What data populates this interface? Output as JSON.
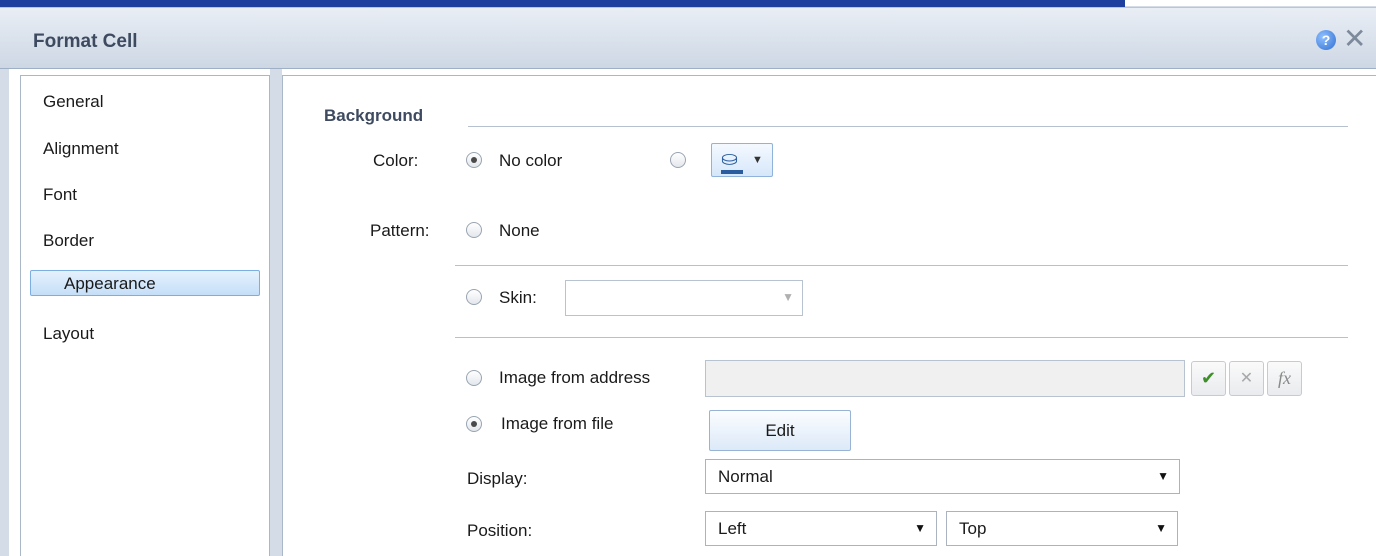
{
  "dialog": {
    "title": "Format Cell",
    "help_icon": "question-mark-icon",
    "close_icon": "close-x-icon"
  },
  "nav": {
    "items": [
      "General",
      "Alignment",
      "Font",
      "Border",
      "Appearance",
      "Layout"
    ],
    "selected": "Appearance"
  },
  "background": {
    "section_title": "Background",
    "color_label": "Color:",
    "no_color_label": "No color",
    "no_color_checked": true,
    "custom_color_checked": false,
    "color_picker_icon": "paint-bucket-icon",
    "pattern_label": "Pattern:",
    "none_label": "None",
    "skin_label": "Skin:",
    "skin_value": "",
    "image_address_label": "Image from address",
    "image_address_value": "",
    "confirm_icon": "checkmark-icon",
    "cancel_icon": "x-icon",
    "fx_label": "fx",
    "image_file_label": "Image from file",
    "image_file_checked": true,
    "edit_label": "Edit",
    "display_label": "Display:",
    "display_value": "Normal",
    "position_label": "Position:",
    "position_h_value": "Left",
    "position_v_value": "Top"
  },
  "colors": {
    "title_bar_top": "#e9eef5",
    "title_bar_bottom": "#cdd7e4",
    "accent_bar": "#1e3f9e",
    "selection": "#c5dff8"
  }
}
